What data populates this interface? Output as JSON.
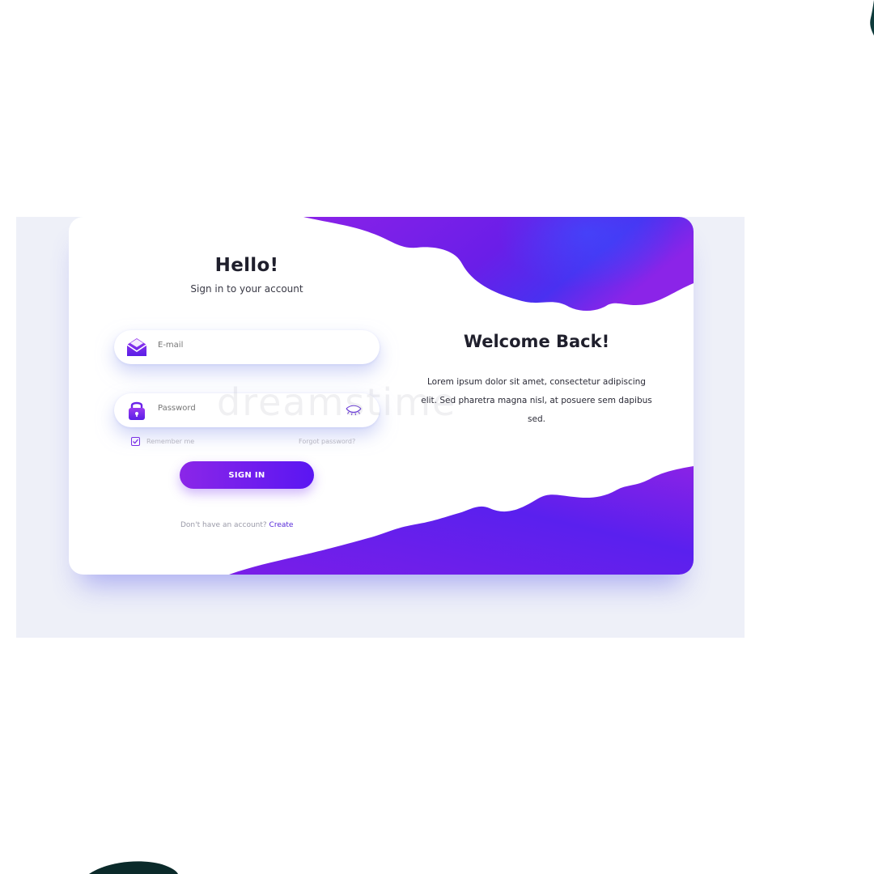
{
  "login": {
    "title": "Hello!",
    "subtitle": "Sign in to your account",
    "email_placeholder": "E-mail",
    "password_placeholder": "Password",
    "remember_label": "Remember me",
    "forgot_label": "Forgot password?",
    "signin_label": "SIGN IN",
    "no_account_text": "Don't have an account?",
    "create_label": "Create",
    "remember_checked": true
  },
  "welcome": {
    "title": "Welcome Back!",
    "body": "Lorem ipsum dolor sit amet, consectetur adipiscing elit. Sed pharetra magna nisl, at posuere sem dapibus sed."
  },
  "watermark": {
    "text": "dreamstime"
  },
  "icons": {
    "email": "envelope-icon",
    "password": "lock-icon",
    "toggle_visibility": "eye-closed-icon",
    "checkbox": "check-icon"
  },
  "colors": {
    "accent_purple": "#7a1fe6",
    "accent_blue": "#4a2cf0",
    "page_background": "#eef0f8",
    "card_background": "#ffffff"
  }
}
